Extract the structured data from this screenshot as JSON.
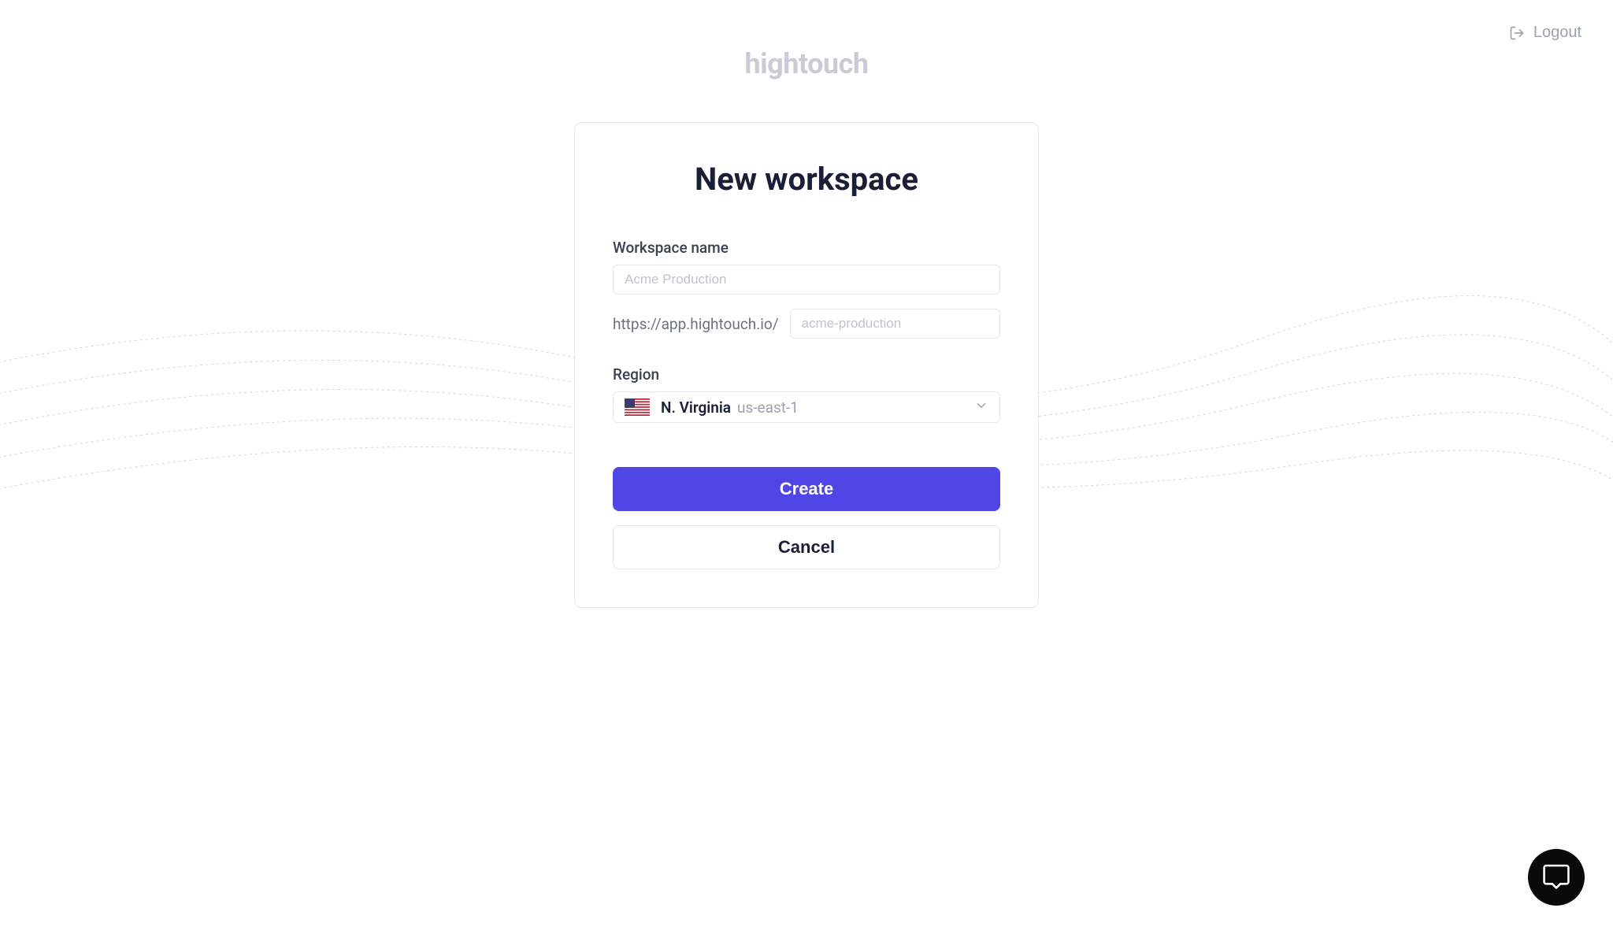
{
  "header": {
    "brand": "hightouch",
    "logout_label": "Logout"
  },
  "card": {
    "title": "New workspace",
    "workspace_name_label": "Workspace name",
    "workspace_name_placeholder": "Acme Production",
    "workspace_name_value": "",
    "url_prefix": "https://app.hightouch.io/",
    "slug_placeholder": "acme-production",
    "slug_value": "",
    "region_label": "Region",
    "region_selected_name": "N. Virginia",
    "region_selected_code": "us-east-1",
    "create_button": "Create",
    "cancel_button": "Cancel"
  },
  "colors": {
    "primary": "#4f46e5",
    "text_dark": "#1a1f36",
    "text_muted": "#9ca3af",
    "border": "#e5e7eb",
    "brand_gray": "#c9cbd6"
  }
}
